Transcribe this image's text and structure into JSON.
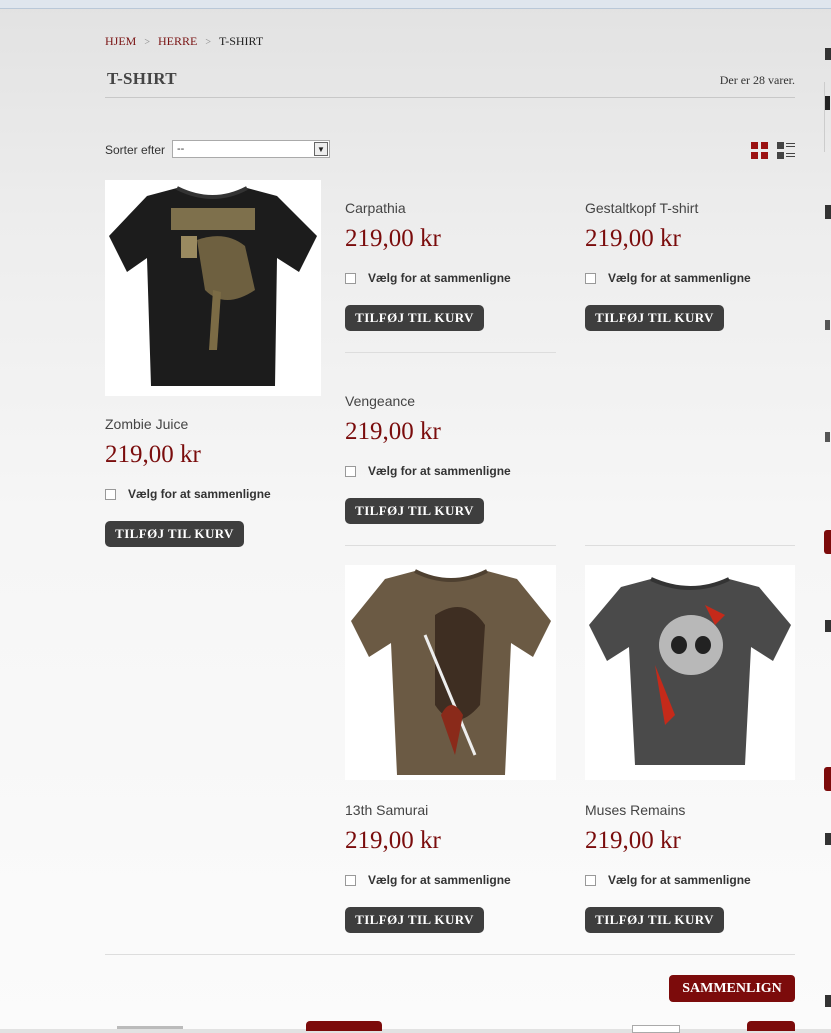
{
  "breadcrumb": {
    "home": "HJEM",
    "parent": "HERRE",
    "current": "T-SHIRT",
    "separator": ">"
  },
  "page": {
    "title": "T-SHIRT",
    "count_text": "Der er 28 varer."
  },
  "sort": {
    "label": "Sorter efter",
    "value": "--"
  },
  "view_modes": {
    "grid_icon": "grid-view-icon",
    "list_icon": "list-view-icon"
  },
  "products": [
    {
      "name": "Zombie Juice",
      "price": "219,00 kr",
      "compare": "Vælg for at sammenligne",
      "button": "TILFØJ TIL KURV"
    },
    {
      "name": "Carpathia",
      "price": "219,00 kr",
      "compare": "Vælg for at sammenligne",
      "button": "TILFØJ TIL KURV"
    },
    {
      "name": "Gestaltkopf T-shirt",
      "price": "219,00 kr",
      "compare": "Vælg for at sammenligne",
      "button": "TILFØJ TIL KURV"
    },
    {
      "name": "Vengeance",
      "price": "219,00 kr",
      "compare": "Vælg for at sammenligne",
      "button": "TILFØJ TIL KURV"
    },
    {
      "name": "13th Samurai",
      "price": "219,00 kr",
      "compare": "Vælg for at sammenligne",
      "button": "TILFØJ TIL KURV"
    },
    {
      "name": "Muses Remains",
      "price": "219,00 kr",
      "compare": "Vælg for at sammenligne",
      "button": "TILFØJ TIL KURV"
    }
  ],
  "compare_button": "SAMMENLIGN",
  "colors": {
    "accent": "#7a0c0c",
    "button": "#3e3e3e"
  }
}
